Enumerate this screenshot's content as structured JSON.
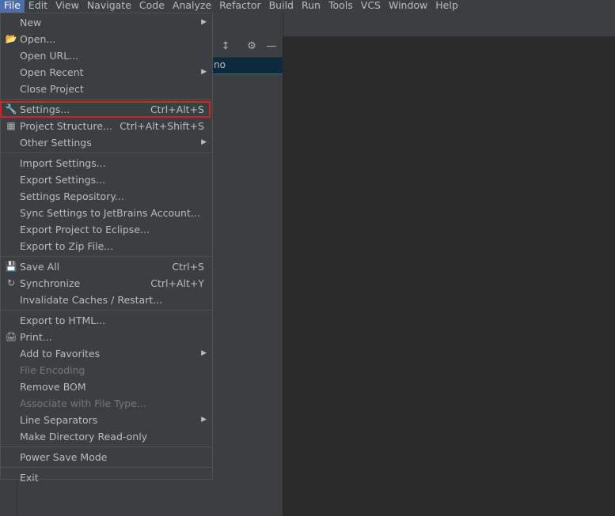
{
  "menubar": {
    "items": [
      "File",
      "Edit",
      "View",
      "Navigate",
      "Code",
      "Analyze",
      "Refactor",
      "Build",
      "Run",
      "Tools",
      "VCS",
      "Window",
      "Help"
    ]
  },
  "project_panel": {
    "selected_text": "no"
  },
  "file_menu": {
    "items": [
      {
        "label": "New",
        "submenu": true
      },
      {
        "label": "Open...",
        "icon": "folder-icon"
      },
      {
        "label": "Open URL..."
      },
      {
        "label": "Open Recent",
        "submenu": true
      },
      {
        "label": "Close Project"
      },
      {
        "label": "Settings...",
        "icon": "wrench-icon",
        "shortcut": "Ctrl+Alt+S",
        "highlight": true
      },
      {
        "label": "Project Structure...",
        "icon": "project-structure-icon",
        "shortcut": "Ctrl+Alt+Shift+S"
      },
      {
        "label": "Other Settings",
        "submenu": true
      },
      {
        "label": "Import Settings..."
      },
      {
        "label": "Export Settings..."
      },
      {
        "label": "Settings Repository..."
      },
      {
        "label": "Sync Settings to JetBrains Account..."
      },
      {
        "label": "Export Project to Eclipse..."
      },
      {
        "label": "Export to Zip File..."
      },
      {
        "label": "Save All",
        "icon": "save-icon",
        "shortcut": "Ctrl+S"
      },
      {
        "label": "Synchronize",
        "icon": "sync-icon",
        "shortcut": "Ctrl+Alt+Y"
      },
      {
        "label": "Invalidate Caches / Restart..."
      },
      {
        "label": "Export to HTML..."
      },
      {
        "label": "Print...",
        "icon": "printer-icon"
      },
      {
        "label": "Add to Favorites",
        "submenu": true
      },
      {
        "label": "File Encoding",
        "disabled": true
      },
      {
        "label": "Remove BOM"
      },
      {
        "label": "Associate with File Type...",
        "disabled": true
      },
      {
        "label": "Line Separators",
        "submenu": true
      },
      {
        "label": "Make Directory Read-only"
      },
      {
        "label": "Power Save Mode"
      },
      {
        "label": "Exit"
      }
    ]
  },
  "colors": {
    "menu_bg": "#3c3f41",
    "active_menu": "#4b6eaf",
    "highlight_border": "#d0232a"
  }
}
